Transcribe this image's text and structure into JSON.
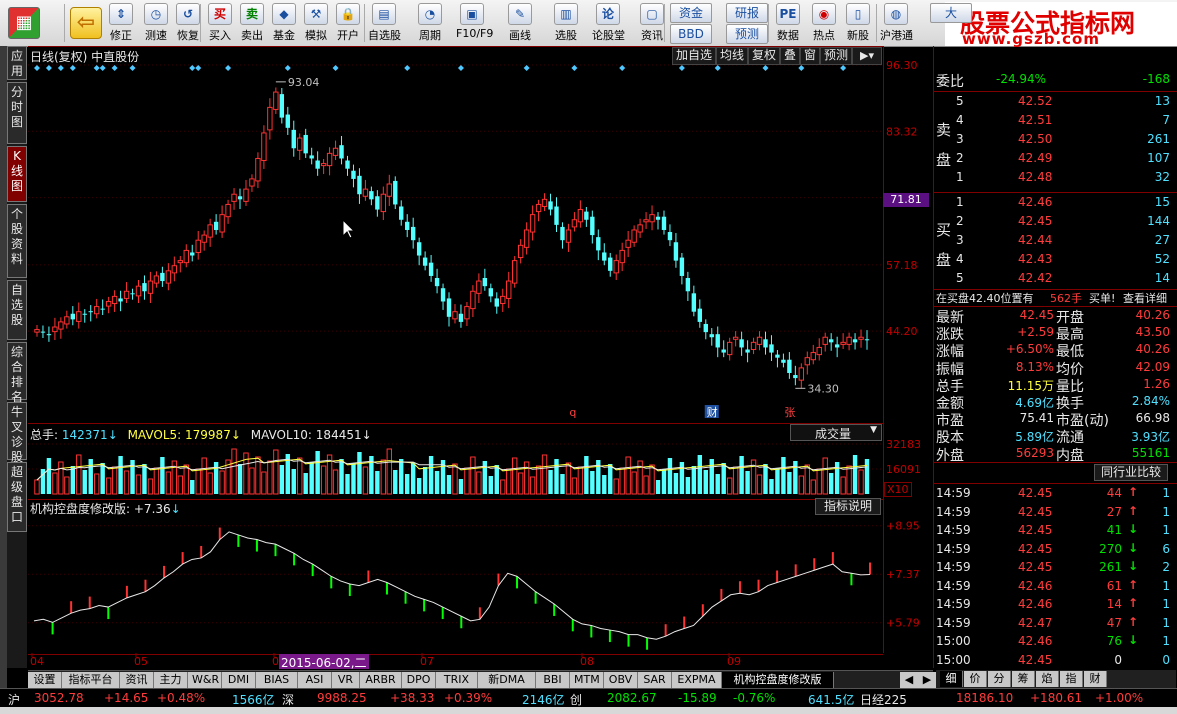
{
  "toolbar": {
    "items": [
      {
        "label": "",
        "icon": "window-grid-icon"
      },
      {
        "label": "",
        "icon": "back-arrow-icon"
      },
      {
        "label": "修正",
        "icon": "up-down-arrows-icon"
      },
      {
        "label": "测速",
        "icon": "clock-icon"
      },
      {
        "label": "恢复",
        "icon": "restore-icon"
      },
      {
        "label": "买入",
        "icon": "buy-icon"
      },
      {
        "label": "卖出",
        "icon": "sell-icon"
      },
      {
        "label": "基金",
        "icon": "fund-icon"
      },
      {
        "label": "模拟",
        "icon": "hammer-icon"
      },
      {
        "label": "开户",
        "icon": "lock-icon"
      },
      {
        "label": "自选股",
        "icon": "self-select-icon"
      },
      {
        "label": "周期",
        "icon": "cycle-icon"
      },
      {
        "label": "F10/F9",
        "icon": "f10-icon"
      },
      {
        "label": "画线",
        "icon": "pen-icon"
      },
      {
        "label": "选股",
        "icon": "stock-pick-icon"
      },
      {
        "label": "论股堂",
        "icon": "forum-icon"
      },
      {
        "label": "资讯",
        "icon": "news-icon"
      },
      {
        "label": "资金",
        "icon": ""
      },
      {
        "label": "BBD",
        "icon": ""
      },
      {
        "label": "研报",
        "icon": ""
      },
      {
        "label": "预测",
        "icon": ""
      },
      {
        "label": "数据",
        "icon": "pe-icon"
      },
      {
        "label": "热点",
        "icon": "hot-icon"
      },
      {
        "label": "新股",
        "icon": "new-stock-icon"
      },
      {
        "label": "沪港通",
        "icon": "sse-hkex-icon"
      },
      {
        "label": "大",
        "icon": ""
      }
    ],
    "logo_line1": "股票公式指标网",
    "logo_line2": "www.gszb.com"
  },
  "left_tabs": [
    "应用",
    "分时图",
    "K线图",
    "个股资料",
    "自选股",
    "综合排名",
    "牛叉诊股",
    "超级盘口"
  ],
  "main_chart": {
    "title": "日线(复权)  中直股份",
    "buttons": [
      "加自选",
      "均线",
      "复权",
      "叠",
      "窗",
      "预测"
    ],
    "high_label": "93.04",
    "low_label": "34.30",
    "current_price_tag": "71.81",
    "event_markers": [
      "q",
      "财",
      "张"
    ],
    "date_tag": "2015-06-02,二"
  },
  "volume_panel": {
    "total_label": "总手:",
    "total_value": "142371",
    "mavol5_label": "MAVOL5:",
    "mavol5_value": "179987",
    "mavol10_label": "MAVOL10:",
    "mavol10_value": "184451",
    "dropdown": "成交量",
    "x10": "X10"
  },
  "indicator_panel": {
    "name": "机构控盘度修改版:",
    "value": "+7.36",
    "explain_button": "指标说明"
  },
  "bottom_tabs": [
    "设置",
    "指标平台",
    "资讯",
    "主力",
    "W&R",
    "DMI",
    "BIAS",
    "ASI",
    "VR",
    "ARBR",
    "DPO",
    "TRIX",
    "新DMA",
    "BBI",
    "MTM",
    "OBV",
    "SAR",
    "EXPMA",
    "机构控盘度修改版"
  ],
  "right_panel": {
    "weibi_label": "委比",
    "weibi_pct": "-24.94%",
    "weibi_diff": "-168",
    "sell_label": "卖盘",
    "buy_label": "买盘",
    "sell_book": [
      {
        "lvl": "5",
        "price": "42.52",
        "vol": "13"
      },
      {
        "lvl": "4",
        "price": "42.51",
        "vol": "7"
      },
      {
        "lvl": "3",
        "price": "42.50",
        "vol": "261"
      },
      {
        "lvl": "2",
        "price": "42.49",
        "vol": "107"
      },
      {
        "lvl": "1",
        "price": "42.48",
        "vol": "32"
      }
    ],
    "buy_book": [
      {
        "lvl": "1",
        "price": "42.46",
        "vol": "15"
      },
      {
        "lvl": "2",
        "price": "42.45",
        "vol": "144"
      },
      {
        "lvl": "3",
        "price": "42.44",
        "vol": "27"
      },
      {
        "lvl": "4",
        "price": "42.43",
        "vol": "52"
      },
      {
        "lvl": "5",
        "price": "42.42",
        "vol": "14"
      }
    ],
    "bid_notice": "在买盘42.40位置有",
    "bid_notice_vol": "562手",
    "bid_notice_action": "买单!",
    "detail_link": "查看详细",
    "quotes": [
      {
        "l1": "最新",
        "v1": "42.45",
        "l2": "开盘",
        "v2": "40.26"
      },
      {
        "l1": "涨跌",
        "v1": "+2.59",
        "l2": "最高",
        "v2": "43.50"
      },
      {
        "l1": "涨幅",
        "v1": "+6.50%",
        "l2": "最低",
        "v2": "40.26"
      },
      {
        "l1": "振幅",
        "v1": "8.13%",
        "l2": "均价",
        "v2": "42.09"
      },
      {
        "l1": "总手",
        "v1": "11.15万",
        "l2": "量比",
        "v2": "1.26"
      },
      {
        "l1": "金额",
        "v1": "4.69亿",
        "l2": "换手",
        "v2": "2.84%"
      },
      {
        "l1": "市盈",
        "v1": "75.41",
        "l2": "市盈(动)",
        "v2": "66.98"
      },
      {
        "l1": "股本",
        "v1": "5.89亿",
        "l2": "流通",
        "v2": "3.93亿"
      },
      {
        "l1": "外盘",
        "v1": "56293",
        "l2": "内盘",
        "v2": "55161"
      }
    ],
    "industry_button": "同行业比较",
    "ticks": [
      {
        "t": "14:59",
        "p": "42.45",
        "v": "44",
        "d": "up",
        "n": "1"
      },
      {
        "t": "14:59",
        "p": "42.45",
        "v": "27",
        "d": "up",
        "n": "1"
      },
      {
        "t": "14:59",
        "p": "42.45",
        "v": "41",
        "d": "down",
        "n": "1"
      },
      {
        "t": "14:59",
        "p": "42.45",
        "v": "270",
        "d": "down",
        "n": "6"
      },
      {
        "t": "14:59",
        "p": "42.45",
        "v": "261",
        "d": "down",
        "n": "2"
      },
      {
        "t": "14:59",
        "p": "42.46",
        "v": "61",
        "d": "up",
        "n": "1"
      },
      {
        "t": "14:59",
        "p": "42.46",
        "v": "14",
        "d": "up",
        "n": "1"
      },
      {
        "t": "14:59",
        "p": "42.47",
        "v": "47",
        "d": "up",
        "n": "1"
      },
      {
        "t": "15:00",
        "p": "42.46",
        "v": "76",
        "d": "down",
        "n": "1"
      },
      {
        "t": "15:00",
        "p": "42.45",
        "v": "0",
        "d": "none",
        "n": "0"
      }
    ],
    "bottom_tabs": [
      "细",
      "价",
      "分",
      "筹",
      "焰",
      "指",
      "财"
    ]
  },
  "status_bar": {
    "sh_label": "沪",
    "sh_index": "3052.78",
    "sh_change": "+14.65",
    "sh_pct": "+0.48%",
    "sh_amount": "1566亿",
    "sz_label": "深",
    "sz_index": "9988.25",
    "sz_change": "+38.33",
    "sz_pct": "+0.39%",
    "sz_amount": "2146亿",
    "cy_label": "创",
    "cy_index": "2082.67",
    "cy_change": "-15.89",
    "cy_pct": "-0.76%",
    "cy_amount": "641.5亿",
    "nk_label": "日经225",
    "nk_index": "18186.10",
    "nk_change": "+180.61",
    "nk_pct": "+1.00%"
  },
  "chart_data": [
    {
      "type": "candlestick",
      "title": "日线(复权)  中直股份",
      "y_ticks": [
        "96.30",
        "83.32",
        "70.34",
        "57.18",
        "44.20"
      ],
      "ylim": [
        31.3,
        96.3
      ],
      "x_ticks": [
        "04",
        "05",
        "06",
        "07",
        "08",
        "09"
      ],
      "close": [
        44.5,
        44,
        43.5,
        45,
        46,
        47,
        46.5,
        48,
        47.5,
        48,
        49,
        48.5,
        50,
        51,
        50,
        52,
        51.5,
        53,
        52,
        54,
        55,
        54,
        56,
        57,
        58,
        60,
        59,
        62,
        63,
        65,
        64,
        67,
        69,
        71,
        70,
        72,
        74,
        78,
        83,
        88,
        91,
        86,
        84,
        80,
        82,
        79,
        78,
        76,
        77,
        79,
        80,
        78,
        76,
        74,
        71,
        72,
        70,
        68,
        71,
        73,
        69,
        66,
        64,
        62,
        59,
        57,
        55,
        53,
        50,
        47,
        48,
        46,
        49,
        52,
        54,
        53,
        51,
        49,
        51,
        54,
        58,
        61,
        64,
        67,
        69,
        70,
        68,
        65,
        62,
        64,
        66,
        68,
        66,
        63,
        60,
        58,
        56,
        58,
        60,
        62,
        64,
        65,
        66,
        67,
        66,
        64,
        62,
        58,
        55,
        52,
        48,
        46,
        44,
        43,
        41,
        40,
        42,
        43,
        41,
        40,
        42,
        43,
        41,
        40,
        39,
        38,
        36,
        35,
        37,
        39,
        40,
        41,
        43,
        42,
        41,
        42,
        43,
        42,
        43,
        42.45
      ]
    },
    {
      "type": "bar",
      "title": "成交量",
      "y_ticks": [
        "32183",
        "16091",
        "X10"
      ]
    },
    {
      "type": "line",
      "title": "机构控盘度修改版",
      "y_ticks": [
        "+8.95",
        "+7.37",
        "+5.79"
      ],
      "ylim": [
        4.9,
        9.3
      ],
      "values": [
        5.85,
        5.9,
        5.8,
        5.95,
        6.1,
        6.2,
        6.25,
        6.35,
        6.3,
        6.45,
        6.6,
        6.7,
        6.8,
        7.0,
        7.25,
        7.45,
        7.7,
        7.85,
        7.9,
        8.1,
        8.5,
        8.75,
        8.65,
        8.55,
        8.5,
        8.4,
        8.35,
        8.2,
        8.05,
        7.85,
        7.7,
        7.5,
        7.3,
        7.15,
        7.05,
        7.0,
        7.1,
        7.2,
        7.1,
        6.95,
        6.8,
        6.65,
        6.55,
        6.45,
        6.3,
        6.15,
        6.0,
        5.85,
        5.9,
        6.3,
        7.0,
        7.4,
        7.3,
        7.05,
        6.8,
        6.6,
        6.4,
        6.15,
        5.9,
        5.75,
        5.7,
        5.6,
        5.55,
        5.5,
        5.4,
        5.4,
        5.3,
        5.25,
        5.35,
        5.5,
        5.6,
        5.7,
        6.0,
        6.3,
        6.5,
        6.7,
        6.75,
        6.7,
        6.8,
        7.0,
        7.1,
        7.2,
        7.3,
        7.4,
        7.5,
        7.6,
        7.7,
        7.45,
        7.4,
        7.35,
        7.36
      ]
    }
  ]
}
